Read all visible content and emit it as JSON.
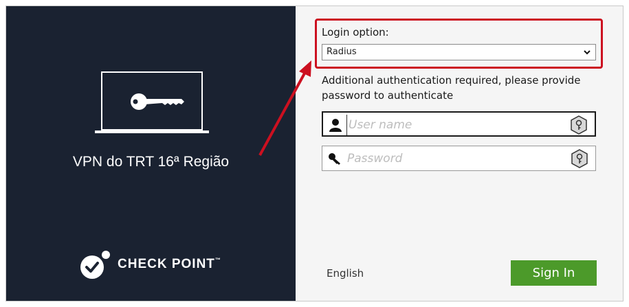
{
  "left_panel": {
    "vpn_title": "VPN do TRT 16ª Região",
    "brand_name": "CHECK POINT",
    "brand_mark": "™"
  },
  "login": {
    "option_label": "Login option:",
    "selected_option": "Radius",
    "auth_message": "Additional authentication required, please provide password to authenticate",
    "username_placeholder": "User name",
    "password_placeholder": "Password",
    "language": "English",
    "sign_in_label": "Sign In"
  },
  "icons": {
    "laptop": "laptop-key-icon",
    "brand": "checkpoint-logo-icon",
    "user": "user-icon",
    "password": "key-icon",
    "keyhole": "keyhole-icon",
    "caret": "chevron-down-icon"
  },
  "colors": {
    "left_panel_bg": "#1a2231",
    "right_panel_bg": "#f5f5f5",
    "sign_in_bg": "#4c9a2a",
    "annotation_red": "#cc1020"
  }
}
